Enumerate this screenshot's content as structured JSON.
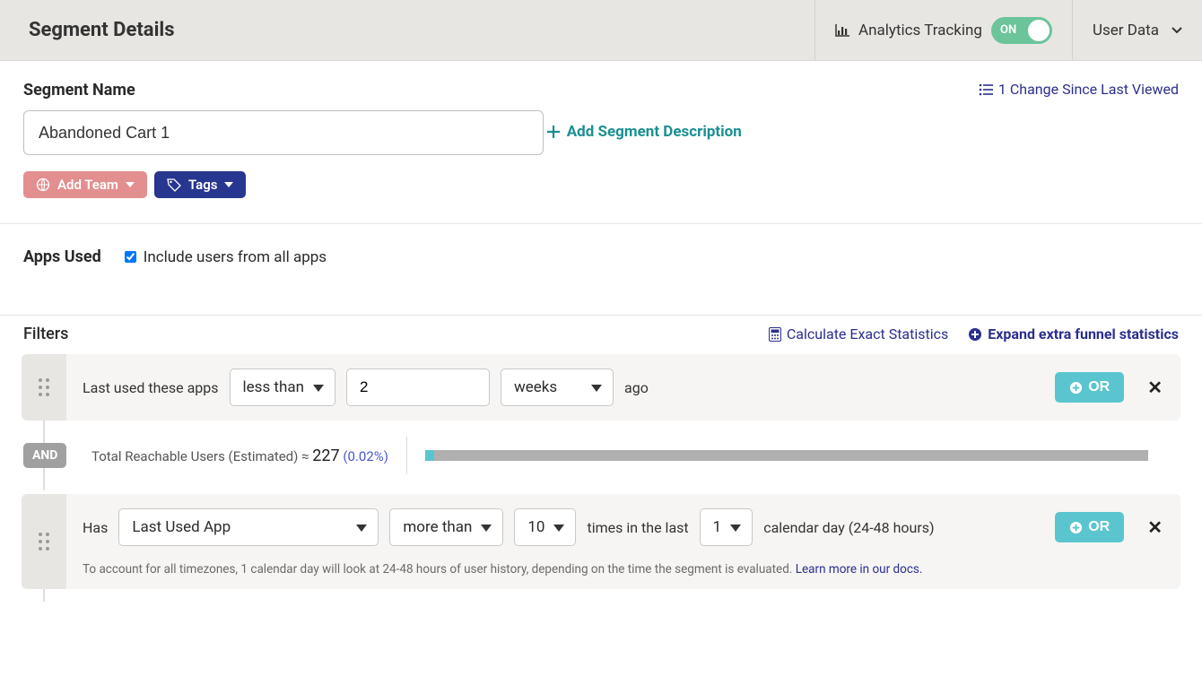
{
  "header": {
    "title": "Segment Details",
    "analytics_label": "Analytics Tracking",
    "toggle_state": "ON",
    "user_data_label": "User Data"
  },
  "segment": {
    "name_label": "Segment Name",
    "name_value": "Abandoned Cart 1",
    "changes_link": "1 Change Since Last Viewed",
    "add_description": "Add Segment Description",
    "add_team": "Add Team",
    "tags": "Tags"
  },
  "apps_used": {
    "label": "Apps Used",
    "include_label": "Include users from all apps",
    "include_checked": true
  },
  "filters": {
    "title": "Filters",
    "calc_link": "Calculate Exact Statistics",
    "expand_link": "Expand extra funnel statistics",
    "or_label": "OR",
    "and_label": "AND",
    "row1": {
      "lead": "Last used these apps",
      "op": "less than",
      "value": "2",
      "unit": "weeks",
      "trail": "ago"
    },
    "stats": {
      "lead": "Total Reachable Users (Estimated) ≈",
      "value": "227",
      "pct": "(0.02%)",
      "bar_pct": 1.2
    },
    "row2": {
      "lead": "Has",
      "event": "Last Used App",
      "op": "more than",
      "value": "10",
      "trail1": "times in the last",
      "days": "1",
      "trail2": "calendar day (24-48 hours)",
      "note": "To account for all timezones, 1 calendar day will look at 24-48 hours of user history, depending on the time the segment is evaluated.",
      "note_link": "Learn more in our docs."
    }
  }
}
